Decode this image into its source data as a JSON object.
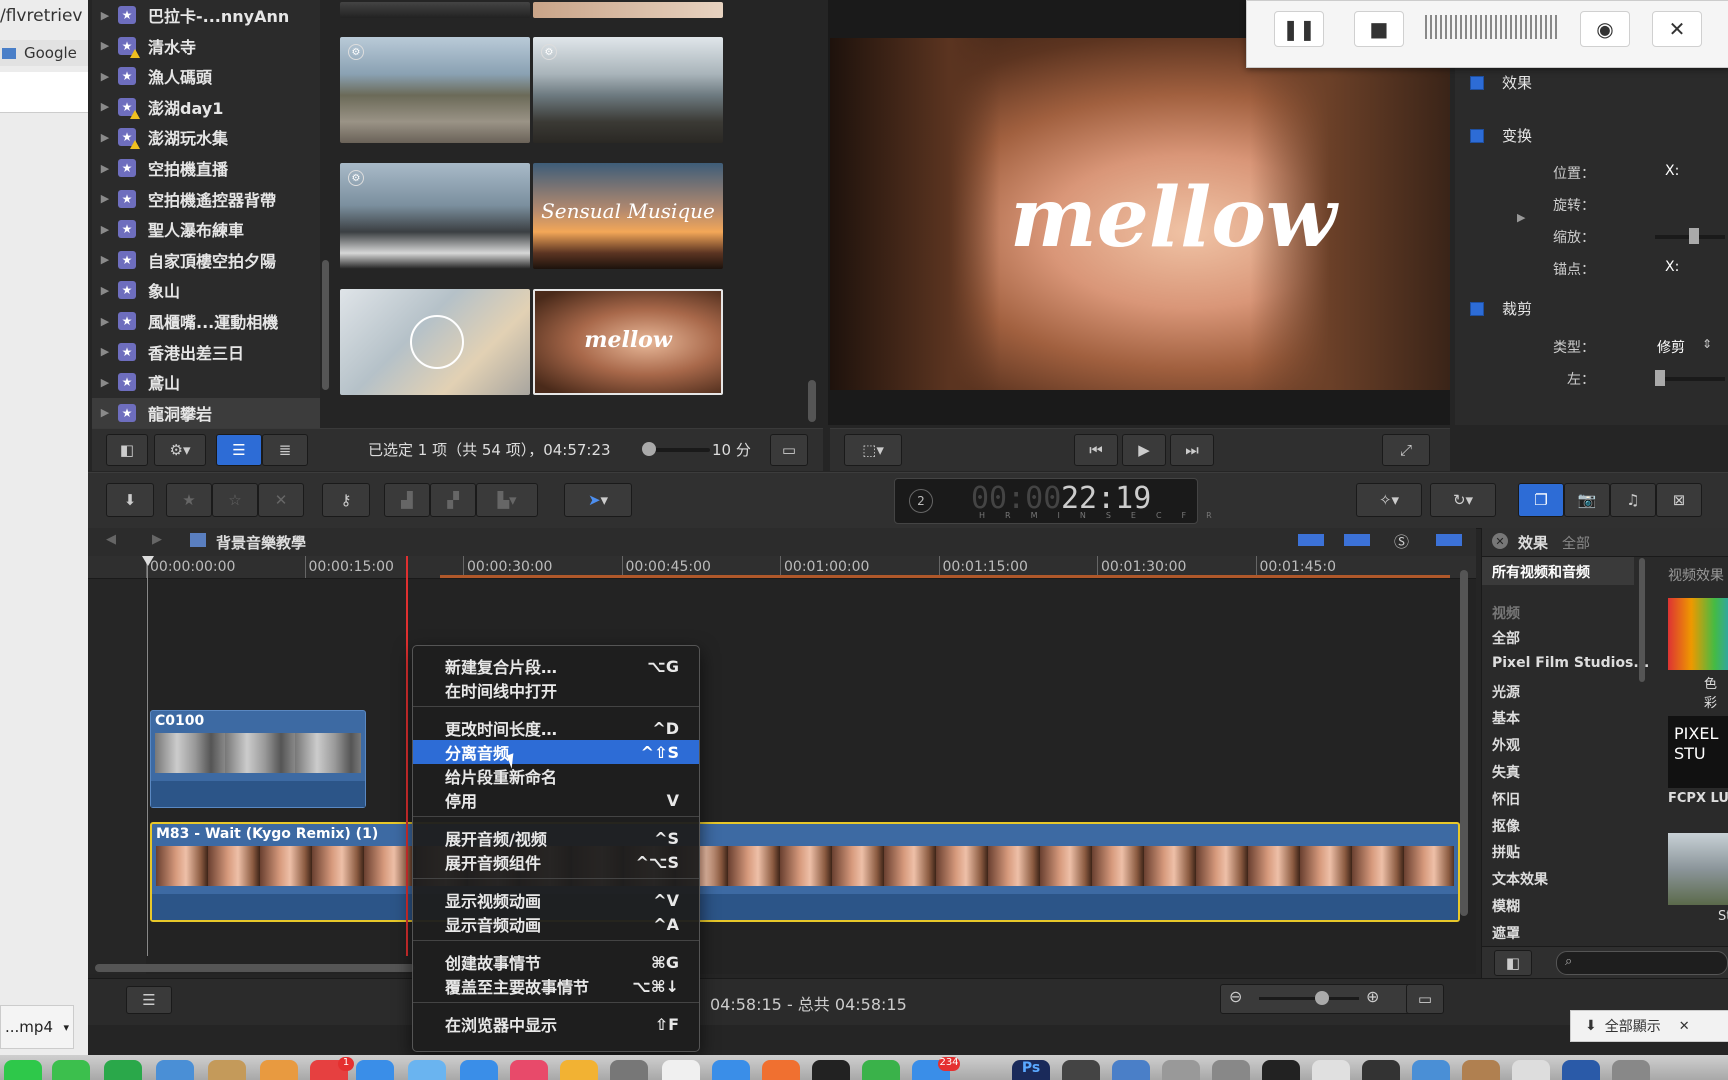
{
  "browser": {
    "url_fragment": "/flvretriev",
    "bookmark": "Google",
    "download_name": "...mp4",
    "download_caret": "▾"
  },
  "library": {
    "items": [
      {
        "label": "巴拉卡-...nnyAnn",
        "warn": false
      },
      {
        "label": "清水寺",
        "warn": true
      },
      {
        "label": "漁人碼頭",
        "warn": false
      },
      {
        "label": "澎湖day1",
        "warn": true
      },
      {
        "label": "澎湖玩水集",
        "warn": true
      },
      {
        "label": "空拍機直播",
        "warn": false
      },
      {
        "label": "空拍機遙控器背帶",
        "warn": false
      },
      {
        "label": "聖人瀑布練車",
        "warn": false
      },
      {
        "label": "自家頂樓空拍夕陽",
        "warn": false
      },
      {
        "label": "象山",
        "warn": false
      },
      {
        "label": "風櫃嘴...運動相機",
        "warn": false
      },
      {
        "label": "香港出差三日",
        "warn": false
      },
      {
        "label": "鳶山",
        "warn": false
      },
      {
        "label": "龍洞攀岩",
        "warn": false,
        "selected": true
      }
    ]
  },
  "browser_pane": {
    "thumb_text_sensual": "Sensual Musique",
    "thumb_text_mellow": "mellow",
    "selection_status": "已选定 1 项（共 54 项），04:57:23",
    "zoom_label": "10 分"
  },
  "viewer": {
    "overlay_title": "mellow"
  },
  "recorder": {
    "pause_icon": "❚❚",
    "stop_icon": "■",
    "close_icon": "✕"
  },
  "inspector": {
    "effects": "效果",
    "transform": "变换",
    "position_label": "位置：",
    "position_x": "X:",
    "rotation_label": "旋转：",
    "scale_label": "缩放：",
    "anchor_label": "锚点：",
    "anchor_x": "X:",
    "crop": "裁剪",
    "type_label": "类型：",
    "type_value": "修剪",
    "left_label": "左："
  },
  "toolbar": {
    "timecode": "22:19",
    "timecode_dim": "00:00",
    "tc_units": [
      "HR",
      "MIN",
      "SEC",
      "FR"
    ],
    "tc_rate": "2"
  },
  "timeline": {
    "project_name": "背景音樂教學",
    "ruler": [
      "00:00:00:00",
      "00:00:15:00",
      "00:00:30:00",
      "00:00:45:00",
      "00:01:00:00",
      "00:01:15:00",
      "00:01:30:00",
      "00:01:45:0"
    ],
    "clips": {
      "c0100": "C0100",
      "m83": "M83 - Wait (Kygo Remix) (1)"
    },
    "status": "04:58:15 - 总共 04:58:15"
  },
  "effects_pane": {
    "title": "效果",
    "tab_all": "全部",
    "selected_category": "所有视频和音频",
    "section_video": "视频",
    "categories": [
      "全部",
      "Pixel Film Studios...",
      "光源",
      "基本",
      "外观",
      "失真",
      "怀旧",
      "抠像",
      "拼贴",
      "文本效果",
      "模糊",
      "遮罩"
    ],
    "preview_header": "视频效果",
    "preview_items": [
      "色彩",
      "FCPX LU",
      "St"
    ],
    "pixel_logo": "PIXEL\nSTU"
  },
  "context_menu": {
    "items": [
      {
        "label": "新建复合片段…",
        "shortcut": "⌥G"
      },
      {
        "label": "在时间线中打开",
        "shortcut": ""
      },
      {
        "label": "更改时间长度…",
        "shortcut": "^D"
      },
      {
        "label": "分离音频",
        "shortcut": "^⇧S",
        "highlighted": true
      },
      {
        "label": "给片段重新命名",
        "shortcut": ""
      },
      {
        "label": "停用",
        "shortcut": "V"
      },
      {
        "label": "展开音频/视频",
        "shortcut": "^S"
      },
      {
        "label": "展开音频组件",
        "shortcut": "^⌥S"
      },
      {
        "label": "显示视频动画",
        "shortcut": "^V"
      },
      {
        "label": "显示音频动画",
        "shortcut": "^A"
      },
      {
        "label": "创建故事情节",
        "shortcut": "⌘G"
      },
      {
        "label": "覆盖至主要故事情节",
        "shortcut": "⌥⌘↓"
      },
      {
        "label": "在浏览器中显示",
        "shortcut": "⇧F"
      }
    ]
  },
  "download_bar": {
    "show_all": "全部顯示",
    "close": "✕"
  },
  "dock": {
    "badge_1": "1",
    "badge_234": "234",
    "ps": "Ps"
  },
  "colors": {
    "accent_blue": "#2d6cd6",
    "playhead_red": "#e03030",
    "selection_yellow": "#e8c82a",
    "clip_blue": "#3d6aa3"
  }
}
